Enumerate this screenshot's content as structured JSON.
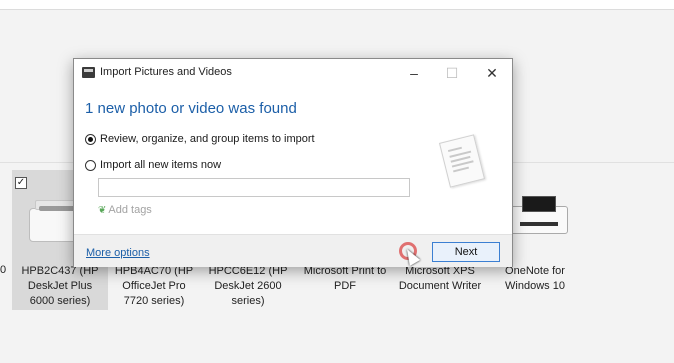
{
  "dialog": {
    "title": "Import Pictures and Videos",
    "heading": "1 new photo or video was found",
    "option_review": "Review, organize, and group items to import",
    "option_import_all": "Import all new items now",
    "add_tags": "Add tags",
    "tag_icon": "tag-icon",
    "more_options": "More options",
    "next": "Next"
  },
  "devices": [
    {
      "label": "HPB2C437 (HP\nDeskJet Plus\n6000 series)",
      "selected": true
    },
    {
      "label": "HPB4AC70 (HP\nOfficeJet Pro\n7720 series)"
    },
    {
      "label": "HPCC6E12 (HP\nDeskJet 2600\nseries)"
    },
    {
      "label": "Microsoft Print to\nPDF"
    },
    {
      "label": "Microsoft XPS\nDocument Writer"
    },
    {
      "label": "OneNote for\nWindows 10"
    }
  ],
  "partial_label": "0",
  "colors": {
    "accent": "#1c5fa8",
    "selected_bg": "#d9d9d9",
    "next_border": "#3b7fd2"
  }
}
